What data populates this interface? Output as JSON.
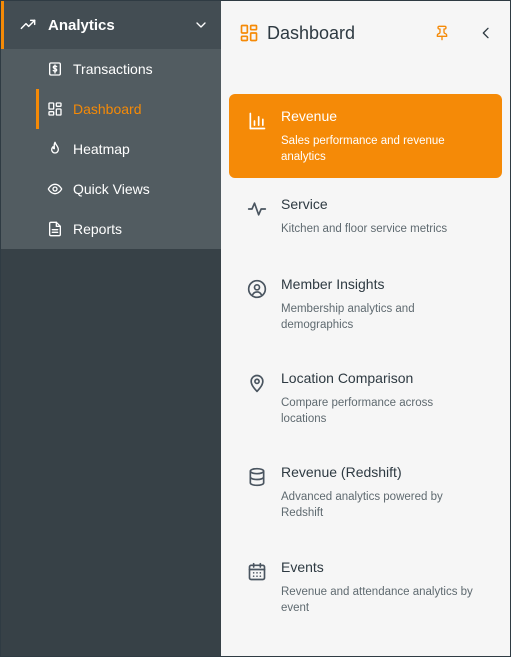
{
  "sidebar": {
    "section": {
      "label": "Analytics",
      "icon": "trending-up-icon",
      "chevron": "chevron-down-icon"
    },
    "items": [
      {
        "label": "Transactions",
        "icon": "dollar-receipt-icon",
        "active": false
      },
      {
        "label": "Dashboard",
        "icon": "dashboard-grid-icon",
        "active": true
      },
      {
        "label": "Heatmap",
        "icon": "flame-icon",
        "active": false
      },
      {
        "label": "Quick Views",
        "icon": "eye-icon",
        "active": false
      },
      {
        "label": "Reports",
        "icon": "document-icon",
        "active": false
      }
    ]
  },
  "panel": {
    "title": "Dashboard",
    "cards": [
      {
        "title": "Revenue",
        "description": "Sales performance and revenue analytics",
        "icon": "bar-chart-icon",
        "active": true
      },
      {
        "title": "Service",
        "description": "Kitchen and floor service metrics",
        "icon": "pulse-icon",
        "active": false
      },
      {
        "title": "Member Insights",
        "description": "Membership analytics and demographics",
        "icon": "user-circle-icon",
        "active": false
      },
      {
        "title": "Location Comparison",
        "description": "Compare performance across locations",
        "icon": "map-pin-icon",
        "active": false
      },
      {
        "title": "Revenue (Redshift)",
        "description": "Advanced analytics powered by Redshift",
        "icon": "database-icon",
        "active": false
      },
      {
        "title": "Events",
        "description": "Revenue and attendance analytics by event",
        "icon": "calendar-icon",
        "active": false
      }
    ]
  },
  "colors": {
    "accent": "#f58a07",
    "sidebar_bg": "#374147",
    "submenu_bg": "#525c61",
    "panel_bg": "#f6f6f6"
  }
}
